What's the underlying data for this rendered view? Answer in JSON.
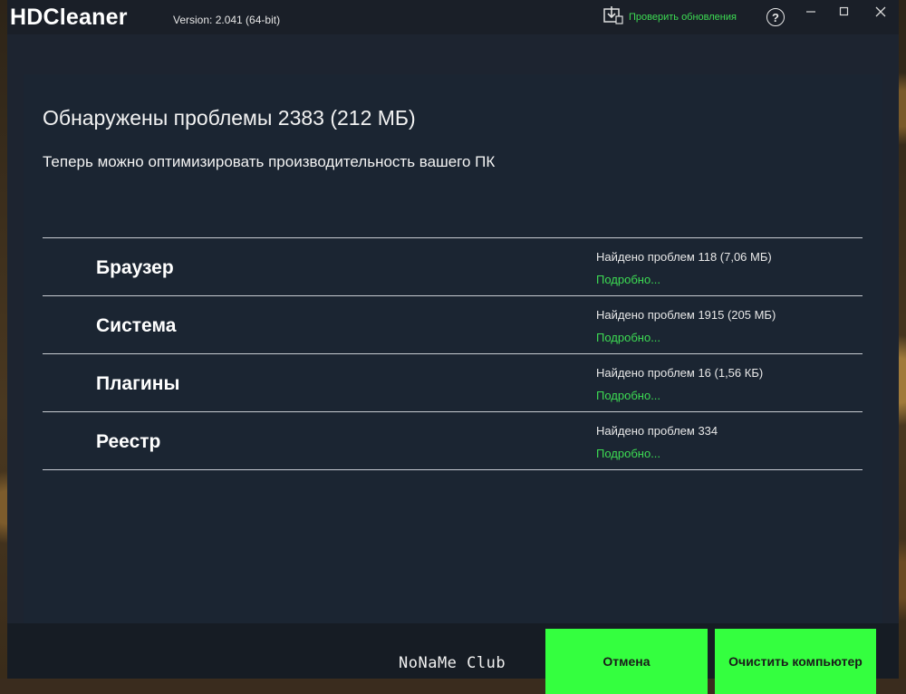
{
  "app": {
    "name": "HDCleaner",
    "version": "Version: 2.041 (64-bit)",
    "update_label": "Проверить обновления",
    "help_label": "?"
  },
  "results": {
    "headline": "Обнаружены проблемы 2383 (212 МБ)",
    "subline": "Теперь можно оптимизировать производительность вашего ПК",
    "items": [
      {
        "title": "Браузер",
        "found": "Найдено проблем 118 (7,06 МБ)",
        "details": "Подробно..."
      },
      {
        "title": "Система",
        "found": "Найдено проблем 1915 (205 МБ)",
        "details": "Подробно..."
      },
      {
        "title": "Плагины",
        "found": "Найдено проблем 16 (1,56 КБ)",
        "details": "Подробно..."
      },
      {
        "title": "Реестр",
        "found": "Найдено проблем 334",
        "details": "Подробно..."
      }
    ]
  },
  "footer": {
    "cancel_label": "Отмена",
    "clean_label": "Очистить компьютер"
  },
  "watermark": "NoNaMe Club",
  "colors": {
    "accent_green": "#34ff3f",
    "link_green": "#3ddc53",
    "window_bg": "#1d2430",
    "panel_bg": "#1b2532"
  }
}
